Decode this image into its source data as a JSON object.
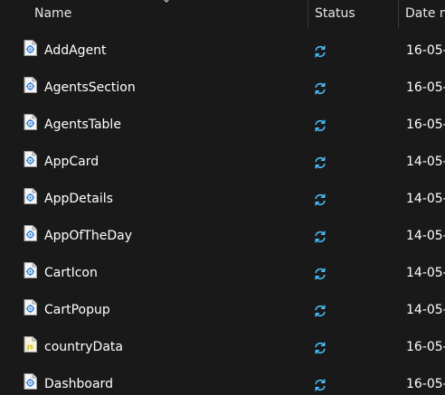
{
  "header": {
    "name_label": "Name",
    "status_label": "Status",
    "date_label": "Date m"
  },
  "files": [
    {
      "name": "AddAgent",
      "icon": "component-file-icon",
      "status": "sync-pending-icon",
      "date": "16-05-"
    },
    {
      "name": "AgentsSection",
      "icon": "component-file-icon",
      "status": "sync-pending-icon",
      "date": "16-05-"
    },
    {
      "name": "AgentsTable",
      "icon": "component-file-icon",
      "status": "sync-pending-icon",
      "date": "16-05-"
    },
    {
      "name": "AppCard",
      "icon": "component-file-icon",
      "status": "sync-pending-icon",
      "date": "14-05-"
    },
    {
      "name": "AppDetails",
      "icon": "component-file-icon",
      "status": "sync-pending-icon",
      "date": "14-05-"
    },
    {
      "name": "AppOfTheDay",
      "icon": "component-file-icon",
      "status": "sync-pending-icon",
      "date": "14-05-"
    },
    {
      "name": "CartIcon",
      "icon": "component-file-icon",
      "status": "sync-pending-icon",
      "date": "14-05-"
    },
    {
      "name": "CartPopup",
      "icon": "component-file-icon",
      "status": "sync-pending-icon",
      "date": "14-05-"
    },
    {
      "name": "countryData",
      "icon": "js-file-icon",
      "status": "sync-pending-icon",
      "date": "16-05-"
    },
    {
      "name": "Dashboard",
      "icon": "component-file-icon",
      "status": "sync-pending-icon",
      "date": "16-05-"
    }
  ],
  "colors": {
    "background": "#191919",
    "sync_blue": "#4cc2ff",
    "js_yellow": "#c8b400"
  }
}
